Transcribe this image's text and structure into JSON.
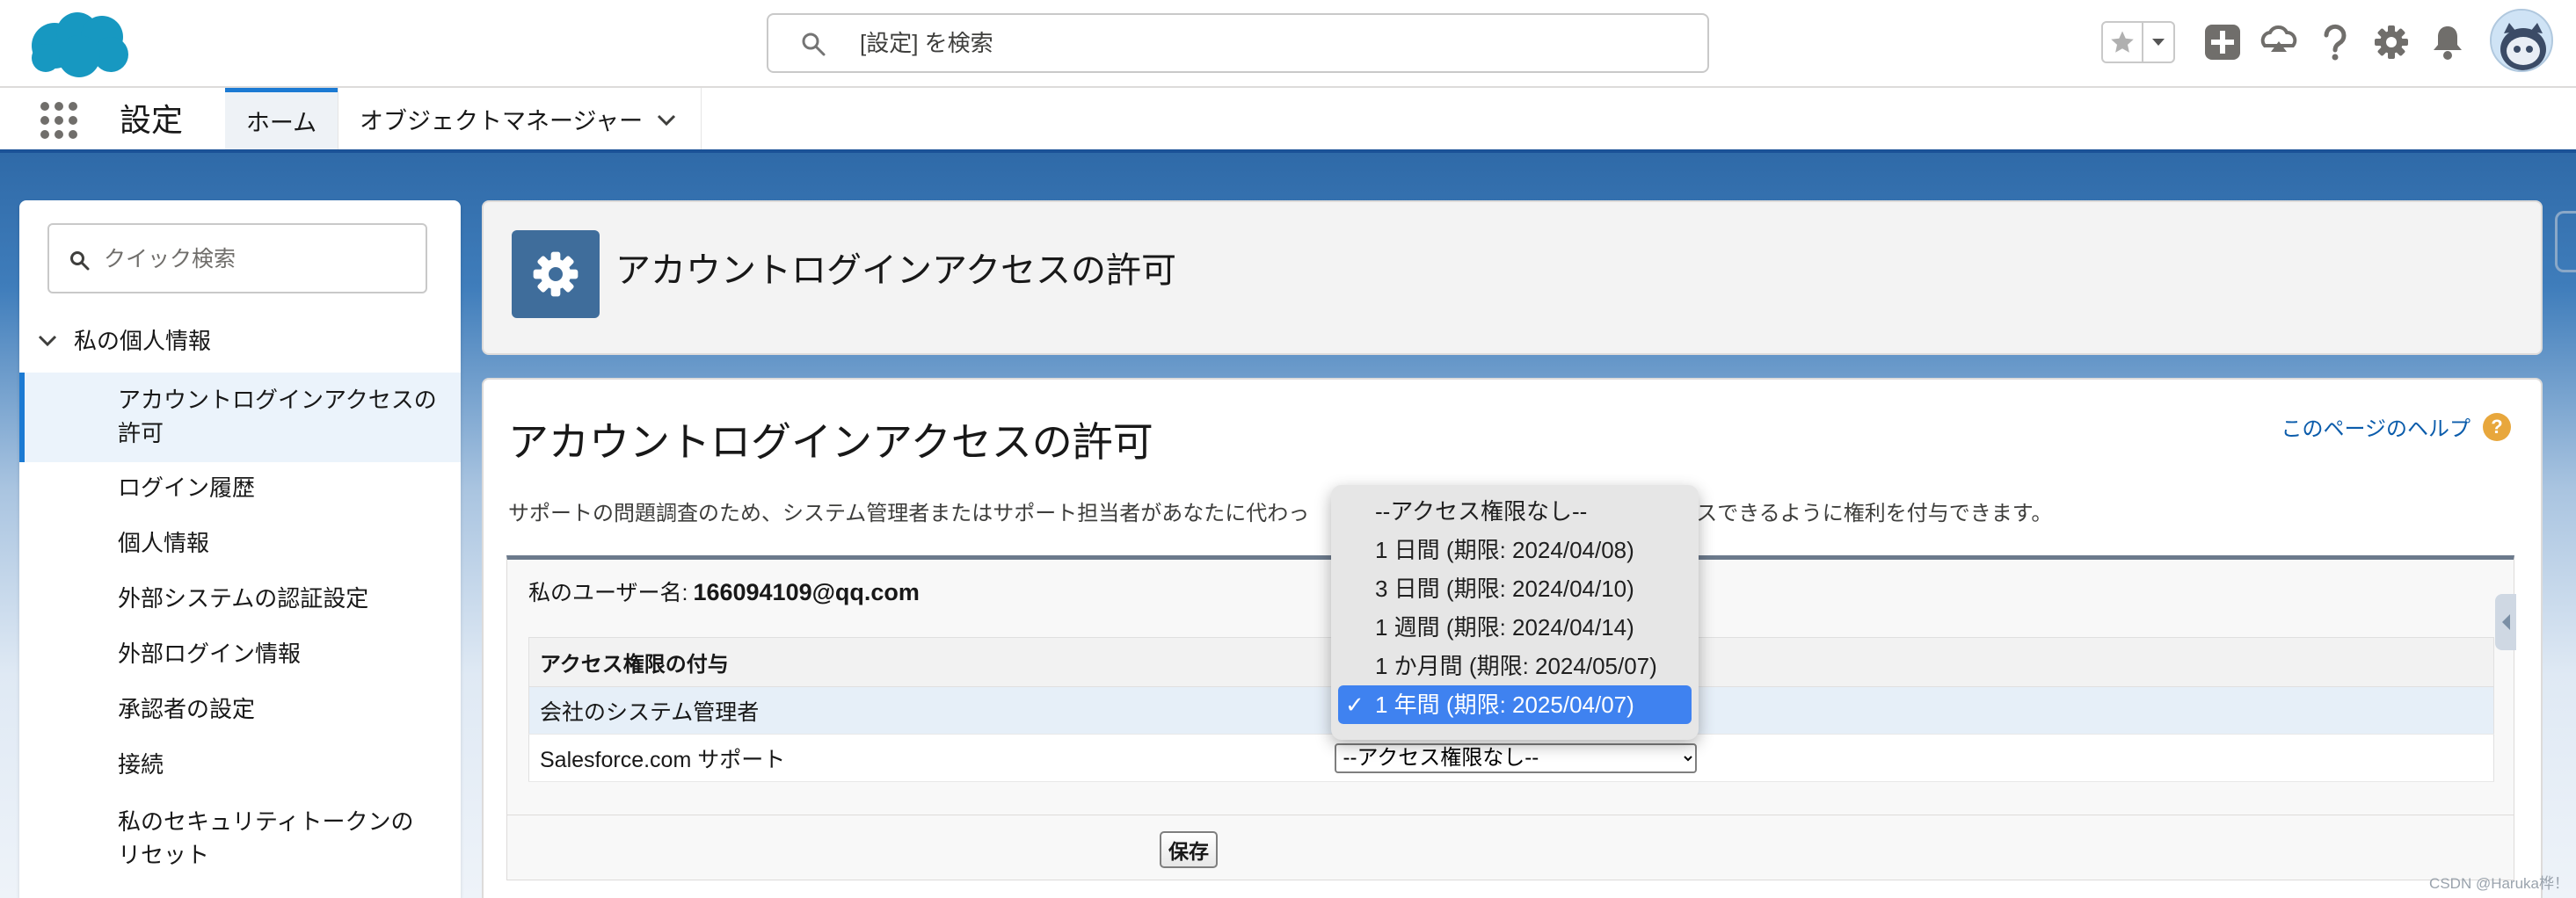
{
  "colors": {
    "brand_blue": "#1b7ad3",
    "nav_underline": "#1b5297",
    "selected_option": "#3f82f0",
    "help_orange": "#e8a73c",
    "link": "#0b5cab"
  },
  "header": {
    "search_placeholder": "[設定] を検索",
    "icons": [
      "salesforce-cloud-icon",
      "favorite-star-icon",
      "chevron-down-icon",
      "global-create-icon",
      "trailhead-icon",
      "help-icon",
      "setup-gear-icon",
      "notification-bell-icon",
      "avatar"
    ]
  },
  "nav": {
    "app_title": "設定",
    "tabs": [
      {
        "label": "ホーム",
        "active": true
      },
      {
        "label": "オブジェクトマネージャー",
        "active": false
      }
    ]
  },
  "sidebar": {
    "quick_find_placeholder": "クイック検索",
    "section_title": "私の個人情報",
    "items": [
      {
        "label": "アカウントログインアクセスの許可",
        "active": true
      },
      {
        "label": "ログイン履歴"
      },
      {
        "label": "個人情報"
      },
      {
        "label": "外部システムの認証設定"
      },
      {
        "label": "外部ログイン情報"
      },
      {
        "label": "承認者の設定"
      },
      {
        "label": "接続"
      },
      {
        "label": "私のセキュリティトークンのリセット"
      }
    ]
  },
  "page_header": {
    "title": "アカウントログインアクセスの許可"
  },
  "content": {
    "title": "アカウントログインアクセスの許可",
    "help_link": "このページのヘルプ",
    "description_before": "サポートの問題調査のため、システム管理者またはサポート担当者があなたに代わっ",
    "description_after": "セスできるように権利を付与できます。",
    "user_label": "私のユーザー名:",
    "user_value": "166094109@qq.com",
    "table_header": "アクセス権限の付与",
    "rows": [
      {
        "label": "会社のシステム管理者",
        "selected": "1 年間 (期限: 2025/04/07)"
      },
      {
        "label": "Salesforce.com サポート",
        "selected": "--アクセス権限なし--"
      }
    ],
    "save_label": "保存"
  },
  "dropdown": {
    "options": [
      "--アクセス権限なし--",
      "1 日間 (期限: 2024/04/08)",
      "3 日間 (期限: 2024/04/10)",
      "1 週間 (期限: 2024/04/14)",
      "1 か月間 (期限: 2024/05/07)",
      "1 年間 (期限: 2025/04/07)"
    ],
    "selected_index": 5,
    "check": "✓"
  },
  "watermark": "CSDN @Haruka桦！"
}
